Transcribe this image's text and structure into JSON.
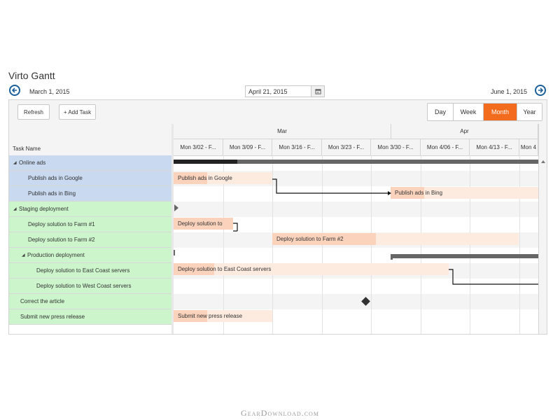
{
  "app": {
    "title": "Virto Gantt"
  },
  "nav": {
    "start_date": "March 1, 2015",
    "current_date": "April 21, 2015",
    "end_date": "June 1, 2015",
    "prev_icon": "arrow-left-circle-icon",
    "next_icon": "arrow-right-circle-icon",
    "calendar_icon": "calendar-icon"
  },
  "toolbar": {
    "refresh_label": "Refresh",
    "add_task_label": "+ Add Task",
    "views": [
      "Day",
      "Week",
      "Month",
      "Year"
    ],
    "selected_view": "Month"
  },
  "grid": {
    "header": "Task Name",
    "rows": [
      {
        "name": "Online ads",
        "expanded": true
      },
      {
        "name": "Publish ads in Google"
      },
      {
        "name": "Publish ads in Bing"
      },
      {
        "name": "Staging deployment",
        "expanded": true
      },
      {
        "name": "Deploy solution to Farm #1"
      },
      {
        "name": "Deploy solution to Farm #2"
      },
      {
        "name": "Production deployment",
        "expanded": true
      },
      {
        "name": "Deploy solution to East Coast servers"
      },
      {
        "name": "Deploy solution to West Coast servers"
      },
      {
        "name": "Correct the article"
      },
      {
        "name": "Submit new press release"
      }
    ]
  },
  "timeline": {
    "months": [
      "Mar",
      "Apr"
    ],
    "weeks": [
      "Mon 3/02 - F...",
      "Mon 3/09 - F...",
      "Mon 3/16 - F...",
      "Mon 3/23 - F...",
      "Mon 3/30 - F...",
      "Mon 4/06 - F...",
      "Mon 4/13 - F...",
      "Mon 4"
    ],
    "bars": [
      {
        "label": "Publish ads in Google"
      },
      {
        "label": "Publish ads in Bing"
      },
      {
        "label": "Deploy solution to"
      },
      {
        "label": "Deploy solution to Farm #2"
      },
      {
        "label": "Deploy solution to East Coast servers"
      },
      {
        "label": "Submit new press release"
      }
    ]
  },
  "colors": {
    "accent": "#f36b1c",
    "nav_icon": "#1c5f99",
    "group_blue": "#c8d9f0",
    "group_green": "#ccf5cc",
    "task_bar": "#fdebe0",
    "task_progress": "#fbd3bd",
    "summary_bar": "#666666"
  },
  "watermark": "GearDownload.com"
}
